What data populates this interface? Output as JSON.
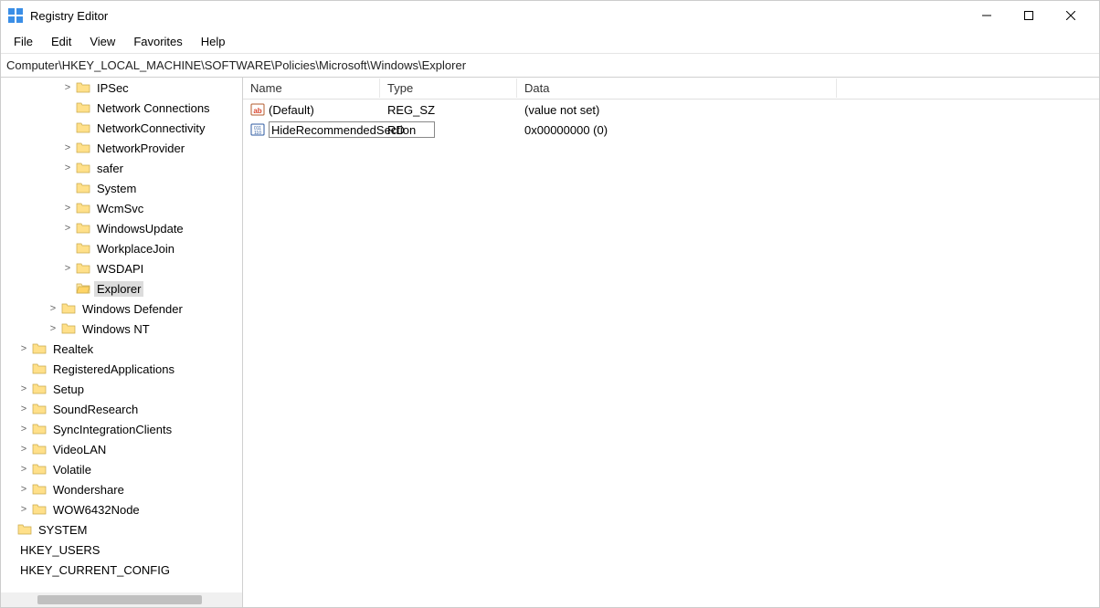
{
  "title": "Registry Editor",
  "menus": {
    "file": "File",
    "edit": "Edit",
    "view": "View",
    "favorites": "Favorites",
    "help": "Help"
  },
  "address": "Computer\\HKEY_LOCAL_MACHINE\\SOFTWARE\\Policies\\Microsoft\\Windows\\Explorer",
  "tree": [
    {
      "indent": 4,
      "exp": ">",
      "icon": true,
      "label": "IPSec"
    },
    {
      "indent": 4,
      "exp": "",
      "icon": true,
      "label": "Network Connections"
    },
    {
      "indent": 4,
      "exp": "",
      "icon": true,
      "label": "NetworkConnectivity"
    },
    {
      "indent": 4,
      "exp": ">",
      "icon": true,
      "label": "NetworkProvider"
    },
    {
      "indent": 4,
      "exp": ">",
      "icon": true,
      "label": "safer"
    },
    {
      "indent": 4,
      "exp": "",
      "icon": true,
      "label": "System"
    },
    {
      "indent": 4,
      "exp": ">",
      "icon": true,
      "label": "WcmSvc"
    },
    {
      "indent": 4,
      "exp": ">",
      "icon": true,
      "label": "WindowsUpdate"
    },
    {
      "indent": 4,
      "exp": "",
      "icon": true,
      "label": "WorkplaceJoin"
    },
    {
      "indent": 4,
      "exp": ">",
      "icon": true,
      "label": "WSDAPI"
    },
    {
      "indent": 4,
      "exp": "",
      "icon": true,
      "label": "Explorer",
      "selected": true,
      "open": true
    },
    {
      "indent": 3,
      "exp": ">",
      "icon": true,
      "label": "Windows Defender"
    },
    {
      "indent": 3,
      "exp": ">",
      "icon": true,
      "label": "Windows NT"
    },
    {
      "indent": 1,
      "exp": ">",
      "icon": true,
      "label": "Realtek"
    },
    {
      "indent": 1,
      "exp": "",
      "icon": true,
      "label": "RegisteredApplications"
    },
    {
      "indent": 1,
      "exp": ">",
      "icon": true,
      "label": "Setup"
    },
    {
      "indent": 1,
      "exp": ">",
      "icon": true,
      "label": "SoundResearch"
    },
    {
      "indent": 1,
      "exp": ">",
      "icon": true,
      "label": "SyncIntegrationClients"
    },
    {
      "indent": 1,
      "exp": ">",
      "icon": true,
      "label": "VideoLAN"
    },
    {
      "indent": 1,
      "exp": ">",
      "icon": true,
      "label": "Volatile"
    },
    {
      "indent": 1,
      "exp": ">",
      "icon": true,
      "label": "Wondershare"
    },
    {
      "indent": 1,
      "exp": ">",
      "icon": true,
      "label": "WOW6432Node"
    },
    {
      "indent": 0,
      "exp": "",
      "icon": true,
      "label": "SYSTEM"
    },
    {
      "indent": 0,
      "exp": "",
      "icon": false,
      "label": "HKEY_USERS"
    },
    {
      "indent": 0,
      "exp": "",
      "icon": false,
      "label": "HKEY_CURRENT_CONFIG"
    }
  ],
  "columns": {
    "name": "Name",
    "type": "Type",
    "data": "Data"
  },
  "values": [
    {
      "icon": "string",
      "name": "(Default)",
      "type": "REG_SZ",
      "data": "(value not set)",
      "editing": false
    },
    {
      "icon": "binary",
      "name": "HideRecommendedSection",
      "type_visible": "RD",
      "type": "REG_DWORD",
      "data": "0x00000000 (0)",
      "editing": true
    }
  ]
}
